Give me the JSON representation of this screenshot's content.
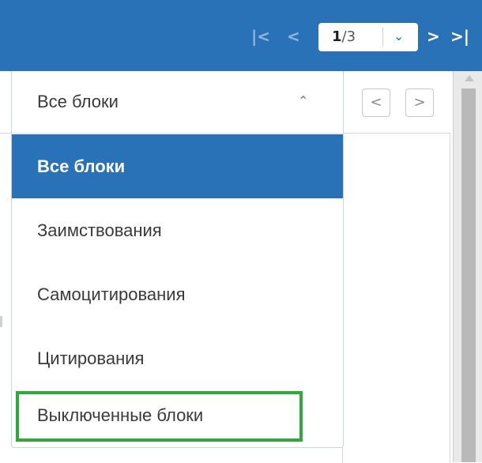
{
  "toolbar": {
    "first_page_icon": "first-page-icon",
    "prev_page_icon": "prev-page-icon",
    "page_current": "1",
    "page_separator_total": "/3",
    "page_dropdown_icon": "chevron-down-icon",
    "next_page_icon": "next-page-icon",
    "last_page_icon": "last-page-icon"
  },
  "dropdown": {
    "selected_value": "Все блоки",
    "options": [
      {
        "label": "Все блоки",
        "selected": true
      },
      {
        "label": "Заимствования",
        "selected": false
      },
      {
        "label": "Самоцитирования",
        "selected": false
      },
      {
        "label": "Цитирования",
        "selected": false
      },
      {
        "label": "Выключенные блоки",
        "selected": false,
        "highlighted": true
      }
    ]
  },
  "colors": {
    "toolbar_bg": "#2a72b8",
    "selected_bg": "#2a72b8",
    "highlight_border": "#2faa3a"
  }
}
